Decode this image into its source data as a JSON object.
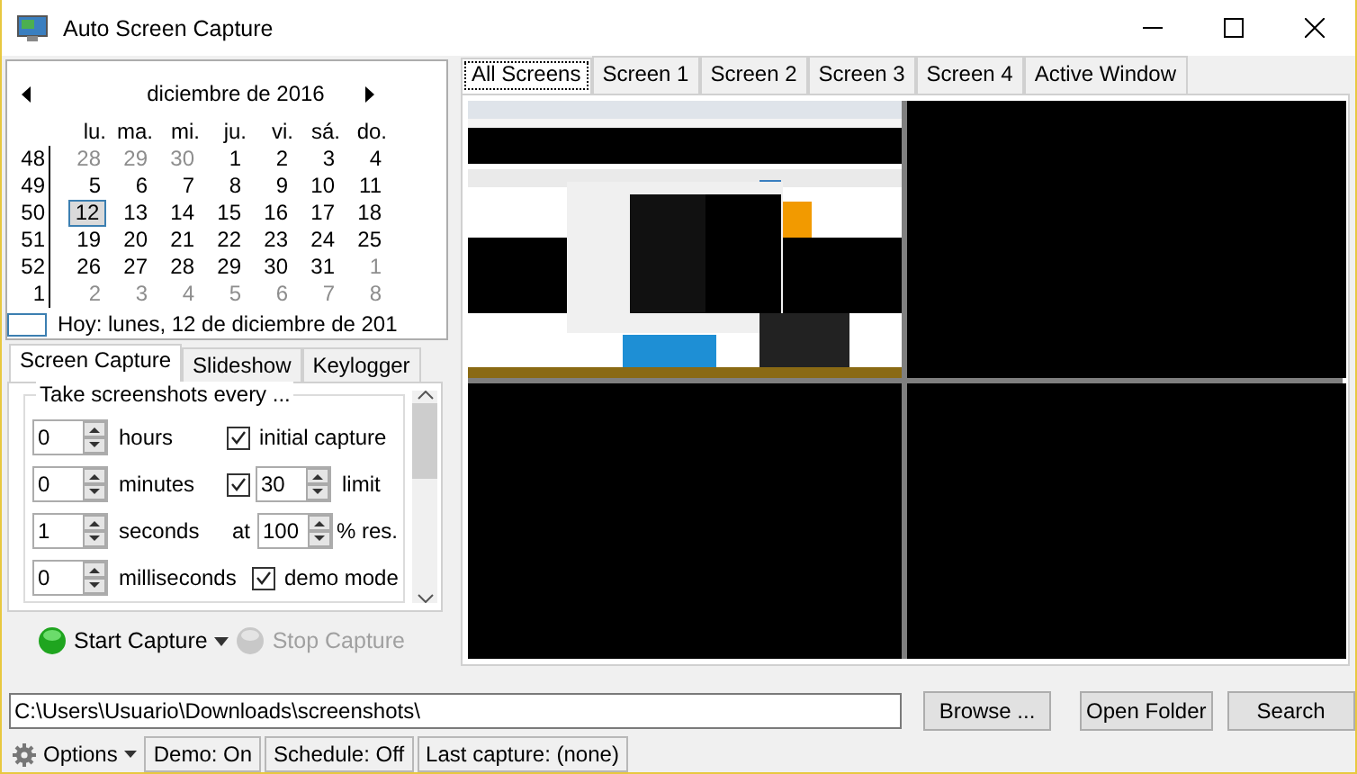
{
  "window": {
    "title": "Auto Screen Capture"
  },
  "calendar": {
    "month_label": "diciembre de 2016",
    "weekdays": [
      "lu.",
      "ma.",
      "mi.",
      "ju.",
      "vi.",
      "sá.",
      "do."
    ],
    "weeks": [
      {
        "number": "48",
        "days": [
          {
            "label": "28",
            "other_month": true,
            "selected": false
          },
          {
            "label": "29",
            "other_month": true,
            "selected": false
          },
          {
            "label": "30",
            "other_month": true,
            "selected": false
          },
          {
            "label": "1",
            "other_month": false,
            "selected": false
          },
          {
            "label": "2",
            "other_month": false,
            "selected": false
          },
          {
            "label": "3",
            "other_month": false,
            "selected": false
          },
          {
            "label": "4",
            "other_month": false,
            "selected": false
          }
        ]
      },
      {
        "number": "49",
        "days": [
          {
            "label": "5",
            "other_month": false,
            "selected": false
          },
          {
            "label": "6",
            "other_month": false,
            "selected": false
          },
          {
            "label": "7",
            "other_month": false,
            "selected": false
          },
          {
            "label": "8",
            "other_month": false,
            "selected": false
          },
          {
            "label": "9",
            "other_month": false,
            "selected": false
          },
          {
            "label": "10",
            "other_month": false,
            "selected": false
          },
          {
            "label": "11",
            "other_month": false,
            "selected": false
          }
        ]
      },
      {
        "number": "50",
        "days": [
          {
            "label": "12",
            "other_month": false,
            "selected": true
          },
          {
            "label": "13",
            "other_month": false,
            "selected": false
          },
          {
            "label": "14",
            "other_month": false,
            "selected": false
          },
          {
            "label": "15",
            "other_month": false,
            "selected": false
          },
          {
            "label": "16",
            "other_month": false,
            "selected": false
          },
          {
            "label": "17",
            "other_month": false,
            "selected": false
          },
          {
            "label": "18",
            "other_month": false,
            "selected": false
          }
        ]
      },
      {
        "number": "51",
        "days": [
          {
            "label": "19",
            "other_month": false,
            "selected": false
          },
          {
            "label": "20",
            "other_month": false,
            "selected": false
          },
          {
            "label": "21",
            "other_month": false,
            "selected": false
          },
          {
            "label": "22",
            "other_month": false,
            "selected": false
          },
          {
            "label": "23",
            "other_month": false,
            "selected": false
          },
          {
            "label": "24",
            "other_month": false,
            "selected": false
          },
          {
            "label": "25",
            "other_month": false,
            "selected": false
          }
        ]
      },
      {
        "number": "52",
        "days": [
          {
            "label": "26",
            "other_month": false,
            "selected": false
          },
          {
            "label": "27",
            "other_month": false,
            "selected": false
          },
          {
            "label": "28",
            "other_month": false,
            "selected": false
          },
          {
            "label": "29",
            "other_month": false,
            "selected": false
          },
          {
            "label": "30",
            "other_month": false,
            "selected": false
          },
          {
            "label": "31",
            "other_month": false,
            "selected": false
          },
          {
            "label": "1",
            "other_month": true,
            "selected": false
          }
        ]
      },
      {
        "number": "1",
        "days": [
          {
            "label": "2",
            "other_month": true,
            "selected": false
          },
          {
            "label": "3",
            "other_month": true,
            "selected": false
          },
          {
            "label": "4",
            "other_month": true,
            "selected": false
          },
          {
            "label": "5",
            "other_month": true,
            "selected": false
          },
          {
            "label": "6",
            "other_month": true,
            "selected": false
          },
          {
            "label": "7",
            "other_month": true,
            "selected": false
          },
          {
            "label": "8",
            "other_month": true,
            "selected": false
          }
        ]
      }
    ],
    "today_label": "Hoy: lunes, 12 de diciembre de 201"
  },
  "settings_tabs": [
    {
      "label": "Screen Capture",
      "selected": true
    },
    {
      "label": "Slideshow",
      "selected": false
    },
    {
      "label": "Keylogger",
      "selected": false
    }
  ],
  "interval": {
    "title": "Take screenshots every ...",
    "rows": [
      {
        "value": "0",
        "unit": "hours",
        "option": {
          "kind": "checkbox",
          "checked": true,
          "label": "initial capture"
        }
      },
      {
        "value": "0",
        "unit": "minutes",
        "option": {
          "kind": "checkbox-spin",
          "checked": true,
          "value": "30",
          "label": "limit"
        }
      },
      {
        "value": "1",
        "unit": "seconds",
        "option": {
          "kind": "spin",
          "prefix": "at",
          "value": "100",
          "label": "% res."
        }
      },
      {
        "value": "0",
        "unit": "milliseconds",
        "option": {
          "kind": "checkbox",
          "checked": true,
          "label": "demo mode"
        }
      }
    ]
  },
  "capture_buttons": [
    {
      "label": "Start Capture",
      "disabled": false
    },
    {
      "label": "Stop Capture",
      "disabled": true
    }
  ],
  "screen_tabs": [
    {
      "label": "All Screens",
      "selected": true
    },
    {
      "label": "Screen 1",
      "selected": false
    },
    {
      "label": "Screen 2",
      "selected": false
    },
    {
      "label": "Screen 3",
      "selected": false
    },
    {
      "label": "Screen 4",
      "selected": false
    },
    {
      "label": "Active Window",
      "selected": false
    }
  ],
  "previews": [
    {
      "kind": "screenshot"
    },
    {
      "kind": "empty"
    },
    {
      "kind": "empty"
    },
    {
      "kind": "empty"
    }
  ],
  "folder": {
    "value": "C:\\Users\\Usuario\\Downloads\\screenshots\\"
  },
  "folder_buttons": [
    "Browse ...",
    "Open Folder",
    "Search"
  ],
  "status_bar": {
    "options_label": "Options",
    "items": [
      "Demo: On",
      "Schedule: Off",
      "Last capture: (none)"
    ]
  }
}
